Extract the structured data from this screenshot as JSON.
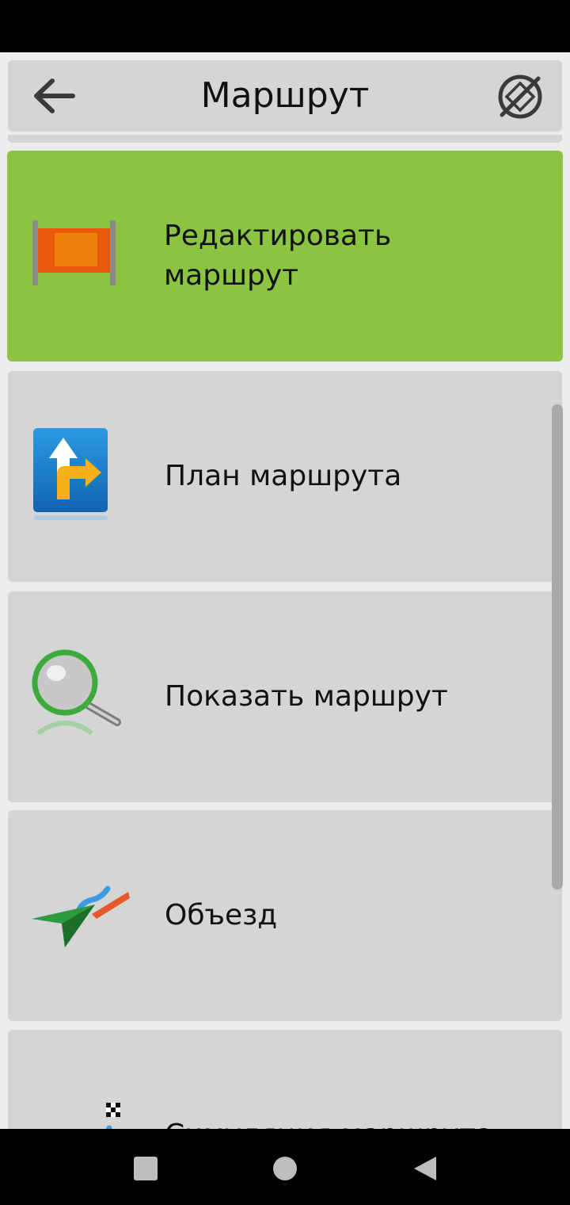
{
  "header": {
    "title": "Маршрут",
    "back_icon": "arrow-left-icon",
    "right_icon": "no-gps-icon"
  },
  "menu": {
    "items": [
      {
        "label": "Редактировать маршрут",
        "icon": "edit-route-icon",
        "active": true
      },
      {
        "label": "План маршрута",
        "icon": "route-plan-icon",
        "active": false
      },
      {
        "label": "Показать маршрут",
        "icon": "magnifier-icon",
        "active": false
      },
      {
        "label": "Объезд",
        "icon": "detour-icon",
        "active": false
      },
      {
        "label": "Симуляция маршрута",
        "icon": "route-simulation-icon",
        "active": false
      }
    ]
  },
  "nav": {
    "recent_icon": "square-icon",
    "home_icon": "circle-icon",
    "back_icon": "triangle-back-icon"
  },
  "colors": {
    "active_item": "#8bc443",
    "item_bg": "#d5d5d5",
    "page_bg": "#ececec"
  }
}
